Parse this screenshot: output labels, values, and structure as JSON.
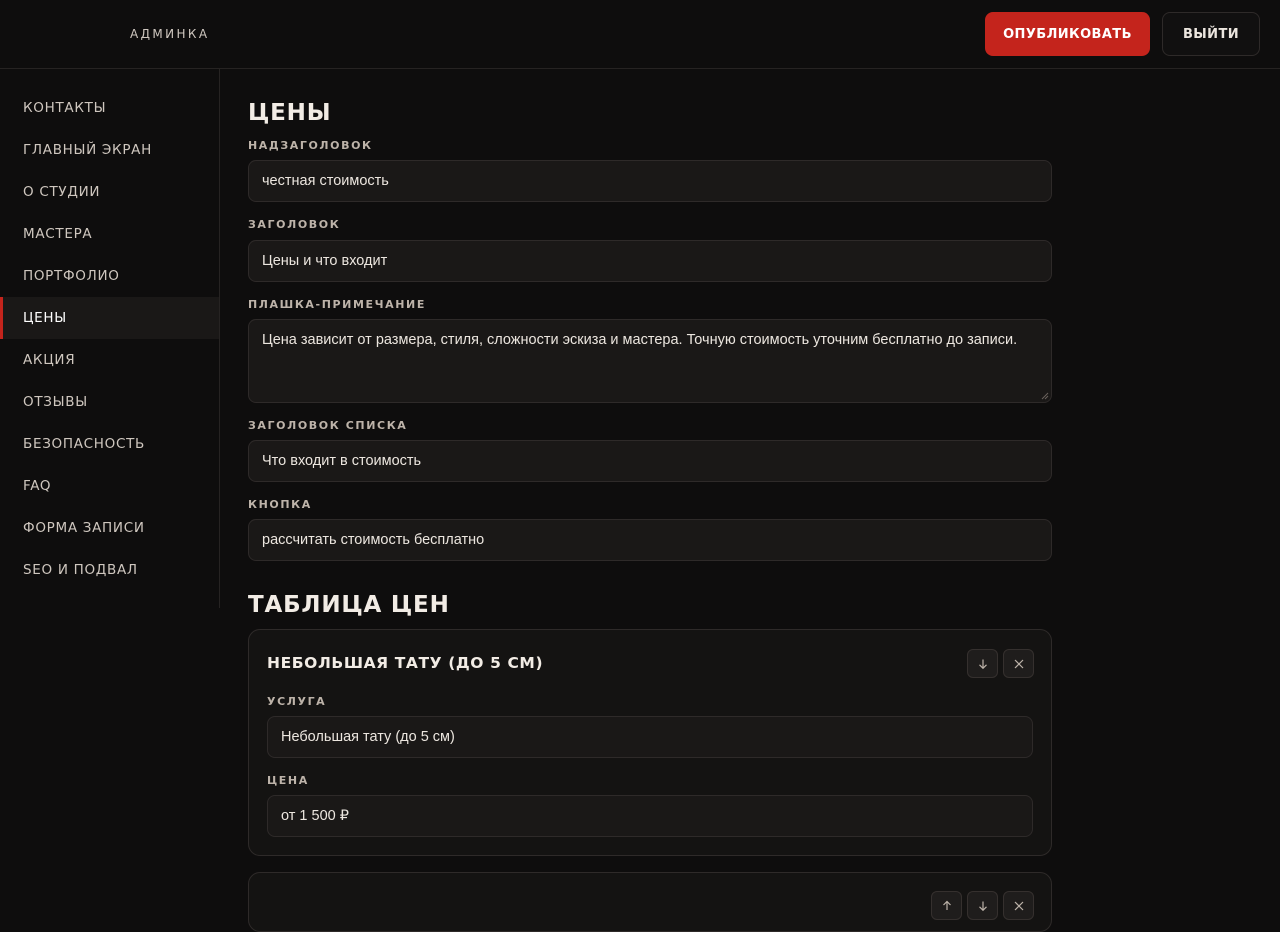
{
  "header": {
    "brand": "АДМИНКА",
    "publish_label": "ОПУБЛИКОВАТЬ",
    "logout_label": "ВЫЙТИ"
  },
  "sidebar": {
    "active_index": 5,
    "items": [
      {
        "label": "КОНТАКТЫ"
      },
      {
        "label": "ГЛАВНЫЙ ЭКРАН"
      },
      {
        "label": "О СТУДИИ"
      },
      {
        "label": "МАСТЕРА"
      },
      {
        "label": "ПОРТФОЛИО"
      },
      {
        "label": "ЦЕНЫ"
      },
      {
        "label": "АКЦИЯ"
      },
      {
        "label": "ОТЗЫВЫ"
      },
      {
        "label": "БЕЗОПАСНОСТЬ"
      },
      {
        "label": "FAQ"
      },
      {
        "label": "ФОРМА ЗАПИСИ"
      },
      {
        "label": "SEO И ПОДВАЛ"
      }
    ]
  },
  "prices": {
    "title": "ЦЕНЫ",
    "overline": {
      "label": "НАДЗАГОЛОВОК",
      "value": "честная стоимость"
    },
    "heading": {
      "label": "ЗАГОЛОВОК",
      "value": "Цены и что входит"
    },
    "note": {
      "label": "ПЛАШКА-ПРИМЕЧАНИЕ",
      "value": "Цена зависит от размера, стиля, сложности эскиза и мастера. Точную стоимость уточним бесплатно до записи."
    },
    "list_heading": {
      "label": "ЗАГОЛОВОК СПИСКА",
      "value": "Что входит в стоимость"
    },
    "button": {
      "label": "КНОПКА",
      "value": "рассчитать стоимость бесплатно"
    }
  },
  "price_table": {
    "title": "ТАБЛИЦА ЦЕН",
    "rows": [
      {
        "title": "НЕБОЛЬШАЯ ТАТУ (ДО 5 СМ)",
        "service_label": "УСЛУГА",
        "service_value": "Небольшая тату (до 5 см)",
        "price_label": "ЦЕНА",
        "price_value": "от 1 500 ₽"
      }
    ]
  },
  "icons": {
    "move_down": "arrow-down-icon",
    "delete": "close-icon"
  },
  "colors": {
    "accent": "#c4241c",
    "background": "#0e0d0d",
    "field_bg": "#1a1817"
  }
}
